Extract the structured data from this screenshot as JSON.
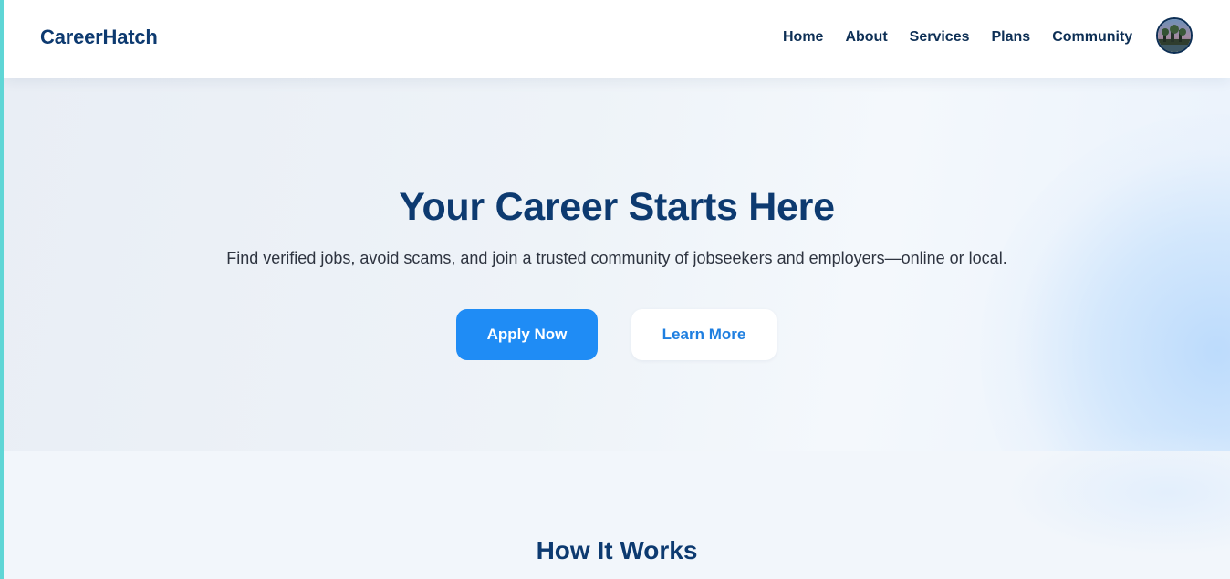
{
  "brand": {
    "name": "CareerHatch"
  },
  "nav": {
    "items": [
      {
        "label": "Home"
      },
      {
        "label": "About"
      },
      {
        "label": "Services"
      },
      {
        "label": "Plans"
      },
      {
        "label": "Community"
      }
    ],
    "avatar_icon": "user-avatar"
  },
  "hero": {
    "title": "Your Career Starts Here",
    "subtitle": "Find verified jobs, avoid scams, and join a trusted community of jobseekers and employers—online or local.",
    "primary_button": "Apply Now",
    "secondary_button": "Learn More"
  },
  "how_it_works": {
    "title": "How It Works"
  },
  "colors": {
    "brand_navy": "#0d3a70",
    "primary_blue": "#1f8cf5",
    "accent_teal": "#5fd6d6"
  }
}
